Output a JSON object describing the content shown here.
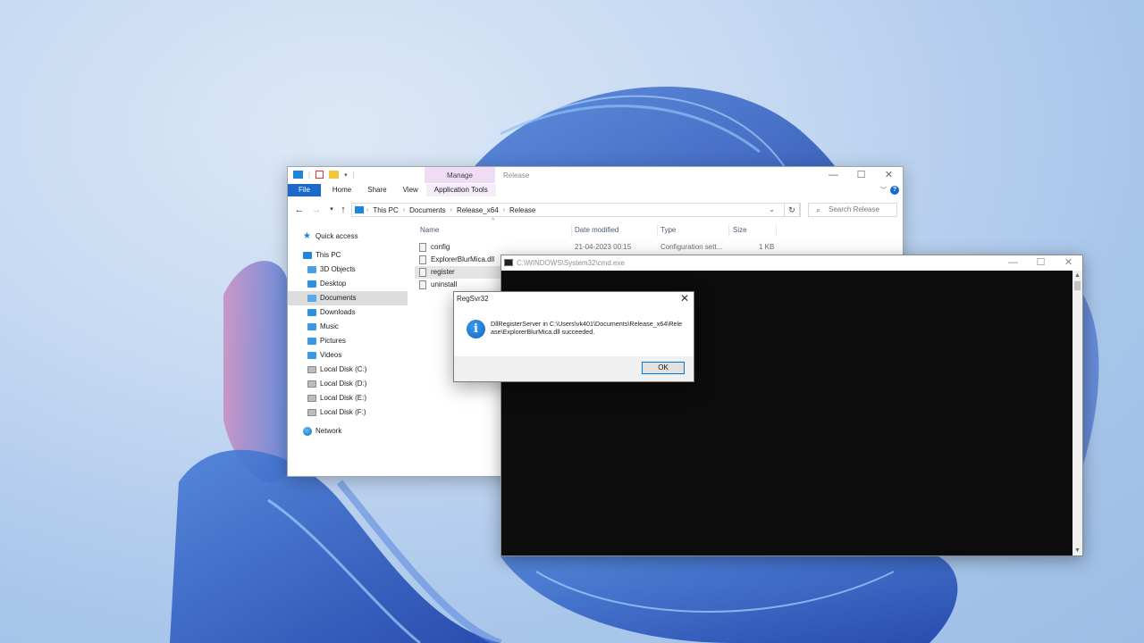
{
  "explorer": {
    "title": "Release",
    "manage_tab": "Manage",
    "ribbon_tabs": [
      "File",
      "Home",
      "Share",
      "View",
      "Application Tools"
    ],
    "breadcrumb": [
      "This PC",
      "Documents",
      "Release_x64",
      "Release"
    ],
    "search_placeholder": "Search Release",
    "sidebar": {
      "quick_access": "Quick access",
      "this_pc": "This PC",
      "items": [
        "3D Objects",
        "Desktop",
        "Documents",
        "Downloads",
        "Music",
        "Pictures",
        "Videos",
        "Local Disk (C:)",
        "Local Disk (D:)",
        "Local Disk (E:)",
        "Local Disk (F:)"
      ],
      "network": "Network",
      "selected": "Documents"
    },
    "columns": [
      "Name",
      "Date modified",
      "Type",
      "Size"
    ],
    "files": [
      {
        "name": "config",
        "date": "21-04-2023 00:15",
        "type": "Configuration sett...",
        "size": "1 KB"
      },
      {
        "name": "ExplorerBlurMica.dll",
        "date": "",
        "type": "",
        "size": ""
      },
      {
        "name": "register",
        "date": "",
        "type": "",
        "size": ""
      },
      {
        "name": "uninstall",
        "date": "",
        "type": "",
        "size": ""
      }
    ],
    "selected_file": "register"
  },
  "cmd": {
    "title": "C:\\WINDOWS\\System32\\cmd.exe"
  },
  "dialog": {
    "title": "RegSvr32",
    "message": "DllRegisterServer in C:\\Users\\vk401\\Documents\\Release_x64\\Release\\ExplorerBlurMica.dll succeeded.",
    "ok_label": "OK"
  },
  "colors": {
    "accent": "#1b6ac9",
    "manage_tab": "#f1dcf5",
    "terminal_bg": "#0c0c0c"
  }
}
